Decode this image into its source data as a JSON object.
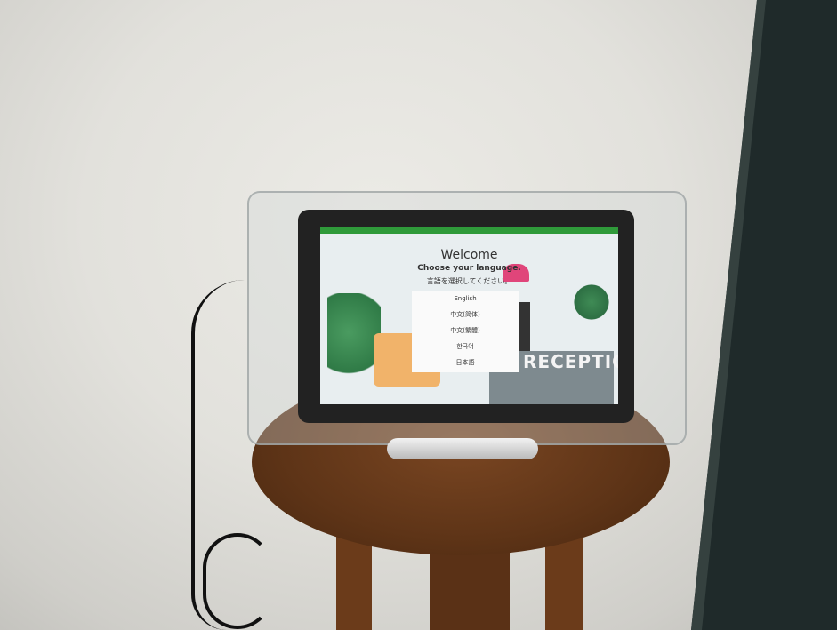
{
  "screen": {
    "title": "Welcome",
    "prompt_en": "Choose your language.",
    "prompt_ja": "言語を選択してください。",
    "languages": [
      "English",
      "中文(简体)",
      "中文(繁體)",
      "한국어",
      "日本語"
    ],
    "background_label": "RECEPTION"
  },
  "colors": {
    "statusbar": "#2f9a3a"
  }
}
